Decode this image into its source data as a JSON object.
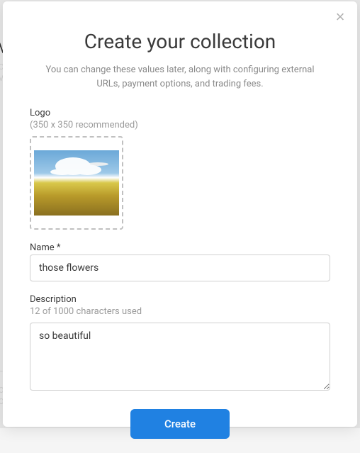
{
  "modal": {
    "title": "Create your collection",
    "subtitle": "You can change these values later, along with configuring external URLs, payment options, and trading fees.",
    "close_label": "×"
  },
  "fields": {
    "logo": {
      "label": "Logo",
      "hint": "(350 x 350 recommended)"
    },
    "name": {
      "label": "Name *",
      "value": "those flowers"
    },
    "description": {
      "label": "Description",
      "hint": "12 of 1000 characters used",
      "value": "so beautiful"
    }
  },
  "actions": {
    "create_label": "Create"
  }
}
